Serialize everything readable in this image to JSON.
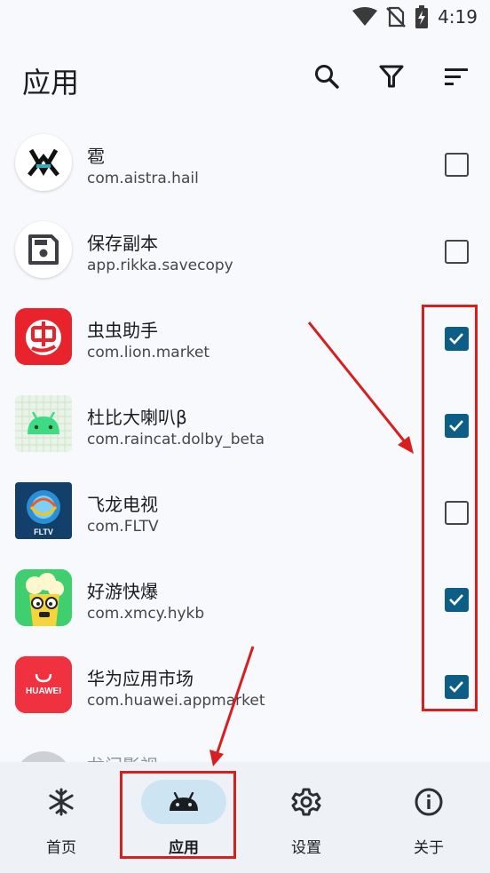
{
  "status_bar": {
    "time": "4:19"
  },
  "app_bar": {
    "title": "应用"
  },
  "apps": [
    {
      "name": "雹",
      "package": "com.aistra.hail",
      "checked": false,
      "icon": "hail-icon"
    },
    {
      "name": "保存副本",
      "package": "app.rikka.savecopy",
      "checked": false,
      "icon": "save-icon"
    },
    {
      "name": "虫虫助手",
      "package": "com.lion.market",
      "checked": true,
      "icon": "chongchong-icon"
    },
    {
      "name": "杜比大喇叭β",
      "package": "com.raincat.dolby_beta",
      "checked": true,
      "icon": "android-icon"
    },
    {
      "name": "飞龙电视",
      "package": "com.FLTV",
      "checked": false,
      "icon": "fltv-icon",
      "icon_text": "FLTV"
    },
    {
      "name": "好游快爆",
      "package": "com.xmcy.hykb",
      "checked": true,
      "icon": "hykb-icon"
    },
    {
      "name": "华为应用市场",
      "package": "com.huawei.appmarket",
      "checked": true,
      "icon": "huawei-icon",
      "icon_text": "HUAWEI"
    },
    {
      "name": "龙门影视",
      "package": "",
      "checked": false,
      "icon": "app-icon"
    }
  ],
  "bottom_nav": [
    {
      "label": "首页",
      "icon": "snowflake-icon",
      "active": false
    },
    {
      "label": "应用",
      "icon": "android-icon",
      "active": true
    },
    {
      "label": "设置",
      "icon": "gear-icon",
      "active": false
    },
    {
      "label": "关于",
      "icon": "info-icon",
      "active": false
    }
  ],
  "colors": {
    "accent": "#0c5e86",
    "nav_active_pill": "#cde5f2",
    "annotation_red": "#d81f1f"
  }
}
